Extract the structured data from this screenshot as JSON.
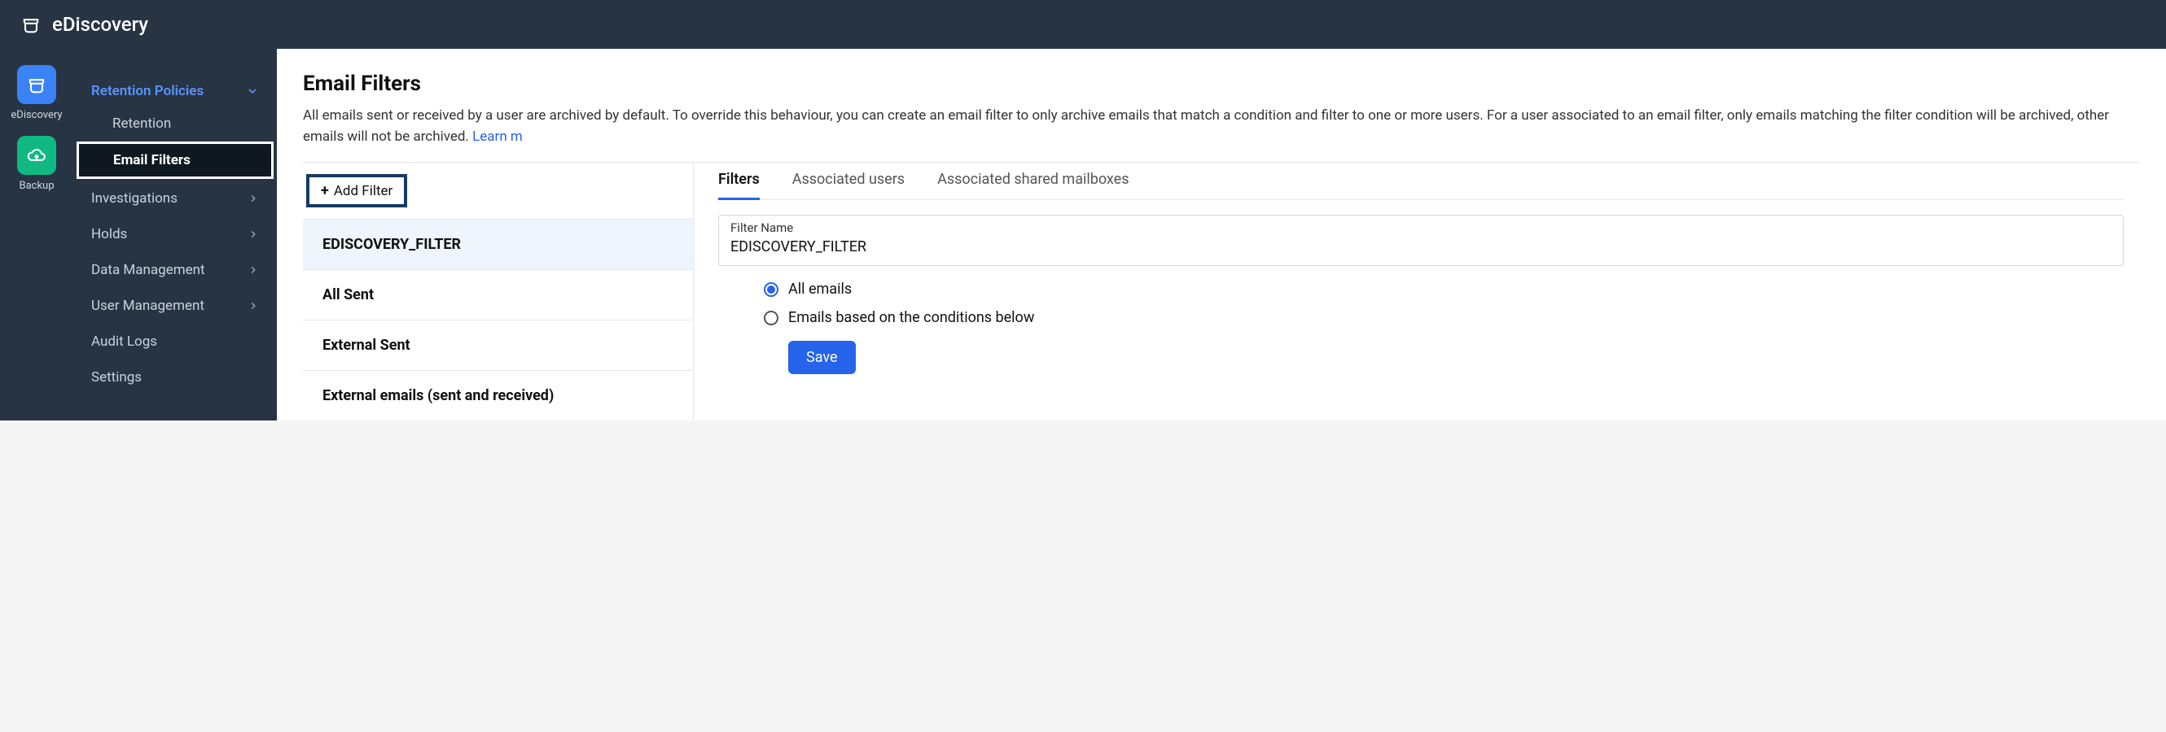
{
  "header": {
    "title": "eDiscovery"
  },
  "iconrail": {
    "items": [
      {
        "label": "eDiscovery",
        "icon": "bucket-icon",
        "style": "active"
      },
      {
        "label": "Backup",
        "icon": "cloud-icon",
        "style": "green"
      }
    ]
  },
  "nav": {
    "group": {
      "label": "Retention Policies",
      "children": [
        {
          "label": "Retention",
          "active": false
        },
        {
          "label": "Email Filters",
          "active": true
        }
      ]
    },
    "items": [
      {
        "label": "Investigations",
        "expandable": true
      },
      {
        "label": "Holds",
        "expandable": true
      },
      {
        "label": "Data Management",
        "expandable": true
      },
      {
        "label": "User Management",
        "expandable": true
      },
      {
        "label": "Audit Logs",
        "expandable": false
      },
      {
        "label": "Settings",
        "expandable": false
      }
    ]
  },
  "page": {
    "title": "Email Filters",
    "description_part1": "All emails sent or received by a user are archived by default. To override this behaviour, you can create an email filter to only archive emails that match a condition and filter to one or more users. For a user associated to an email filter, only emails matching the filter condition will be archived, other emails will not be archived. ",
    "learn_text": "Learn m"
  },
  "left": {
    "add_filter_label": "Add Filter",
    "filters": [
      {
        "name": "EDISCOVERY_FILTER",
        "selected": true
      },
      {
        "name": "All Sent",
        "selected": false
      },
      {
        "name": "External Sent",
        "selected": false
      },
      {
        "name": "External emails (sent and received)",
        "selected": false
      }
    ]
  },
  "right": {
    "tabs": [
      {
        "label": "Filters",
        "active": true
      },
      {
        "label": "Associated users",
        "active": false
      },
      {
        "label": "Associated shared mailboxes",
        "active": false
      }
    ],
    "filter_name_label": "Filter Name",
    "filter_name_value": "EDISCOVERY_FILTER",
    "radio_options": [
      {
        "label": "All emails",
        "selected": true
      },
      {
        "label": "Emails based on the conditions below",
        "selected": false
      }
    ],
    "save_label": "Save"
  }
}
